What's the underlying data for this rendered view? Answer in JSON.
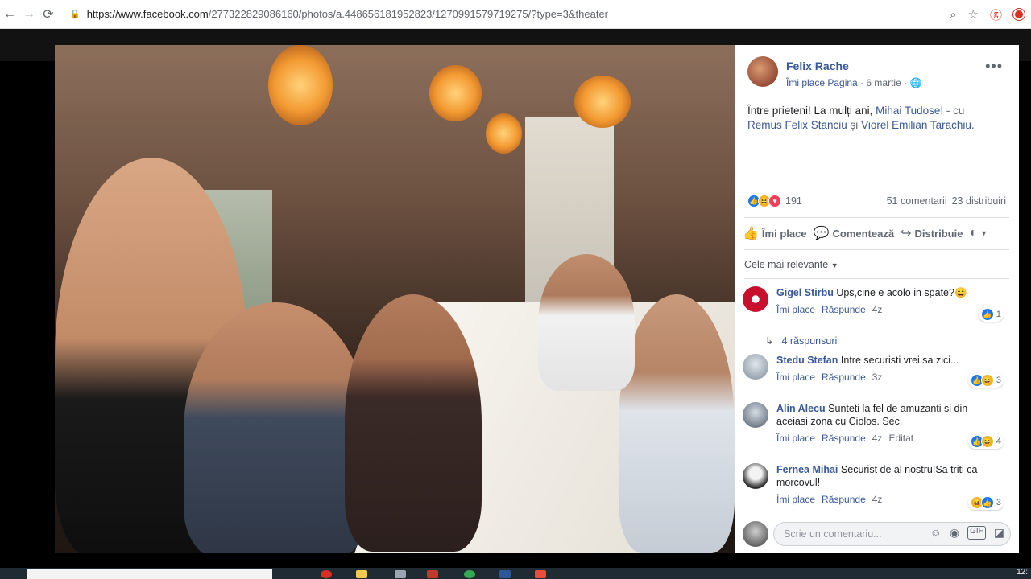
{
  "browser": {
    "url_main": "https://www.facebook.com",
    "url_rest": "/277322829086160/photos/a.448656181952823/1270991579719275/?type=3&theater"
  },
  "post": {
    "author": "Felix Rache",
    "like_page": "Îmi place Pagina",
    "date": "6 martie",
    "text_intro": "Între prieteni! La mulți ani, ",
    "tag_main": "Mihai Tudose!",
    "text_with": " - cu",
    "tag_1": "Remus Felix Stanciu",
    "and": " și ",
    "tag_2": "Viorel Emilian Tarachiu",
    "end": ".",
    "reactions_count": "191",
    "comments_count": "51 comentarii",
    "shares_count": "23 distribuiri",
    "action_like": "Îmi place",
    "action_comment": "Comentează",
    "action_share": "Distribuie",
    "sort_label": "Cele mai relevante"
  },
  "comments": [
    {
      "name": "Gigel Stirbu",
      "text": "Ups,cine e acolo in spate?😄",
      "like": "Îmi place",
      "reply": "Răspunde",
      "time": "4z",
      "edited": "",
      "react_count": "1",
      "avatar_color": "#c8102e"
    },
    {
      "name": "Stedu Stefan",
      "text": "Intre securisti vrei sa zici...",
      "like": "Îmi place",
      "reply": "Răspunde",
      "time": "3z",
      "edited": "",
      "react_count": "3",
      "avatar_color": "#a7b4c2"
    },
    {
      "name": "Alin Alecu",
      "text": "Sunteti la fel de amuzanti si din aceiasi zona cu Ciolos. Sec.",
      "like": "Îmi place",
      "reply": "Răspunde",
      "time": "4z",
      "edited": "Editat",
      "react_count": "4",
      "avatar_color": "#5a6b7c"
    },
    {
      "name": "Fernea Mihai",
      "text": "Securist de al nostru!Sa triti ca morcovul!",
      "like": "Îmi place",
      "reply": "Răspunde",
      "time": "4z",
      "edited": "",
      "react_count": "3",
      "avatar_color": "#3b3b3b"
    }
  ],
  "replies_label": "4 răspunsuri",
  "compose_placeholder": "Scrie un comentariu...",
  "taskbar": {
    "clock": "12:"
  }
}
